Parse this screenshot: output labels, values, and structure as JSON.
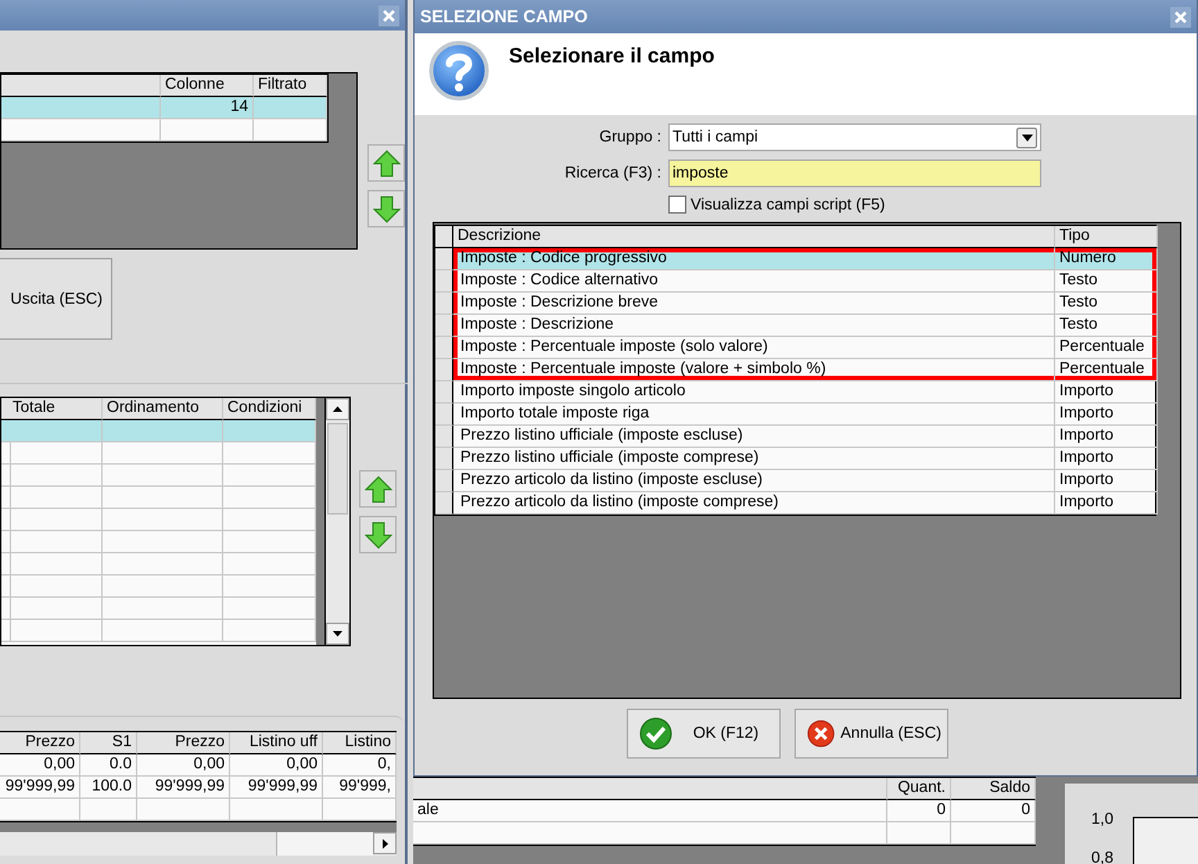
{
  "background_window": {
    "top_table": {
      "columns": [
        "Colonne",
        "Filtrato"
      ],
      "rows": [
        {
          "selected": true,
          "colonne": "14"
        },
        {
          "selected": false
        }
      ]
    },
    "exit_button": "Uscita (ESC)",
    "mid_table": {
      "columns": [
        "Totale",
        "Ordinamento",
        "Condizioni"
      ],
      "rows": [
        {
          "selected": true
        },
        {
          "selected": false
        },
        {
          "selected": false
        },
        {
          "selected": false
        },
        {
          "selected": false
        },
        {
          "selected": false
        },
        {
          "selected": false
        },
        {
          "selected": false
        },
        {
          "selected": false
        },
        {
          "selected": false
        }
      ]
    },
    "bottom_table": {
      "columns": [
        "Prezzo",
        "S1",
        "Prezzo",
        "Listino uff",
        "Listino"
      ],
      "rows": [
        {
          "cells": [
            "0,00",
            "0.0",
            "0,00",
            "0,00",
            "0,"
          ]
        },
        {
          "cells": [
            "99'999,99",
            "100.0",
            "99'999,99",
            "99'999,99",
            "99'999,"
          ]
        }
      ]
    }
  },
  "dialog": {
    "title": "SELEZIONE CAMPO",
    "heading": "Selezionare il campo",
    "group": {
      "label": "Gruppo :",
      "value": "Tutti i campi"
    },
    "search": {
      "label": "Ricerca (F3) :",
      "value": "imposte"
    },
    "script_fields": {
      "label": "Visualizza campi script (F5)",
      "checked": false
    },
    "table": {
      "columns": [
        "Descrizione",
        "Tipo"
      ],
      "rows": [
        {
          "description": "Imposte : Codice progressivo",
          "type": "Numero",
          "selected": true,
          "highlighted": true
        },
        {
          "description": "Imposte : Codice alternativo",
          "type": "Testo",
          "selected": false,
          "highlighted": true
        },
        {
          "description": "Imposte : Descrizione breve",
          "type": "Testo",
          "selected": false,
          "highlighted": true
        },
        {
          "description": "Imposte : Descrizione",
          "type": "Testo",
          "selected": false,
          "highlighted": true
        },
        {
          "description": "Imposte : Percentuale imposte (solo valore)",
          "type": "Percentuale",
          "selected": false,
          "highlighted": true
        },
        {
          "description": "Imposte : Percentuale imposte (valore + simbolo %)",
          "type": "Percentuale",
          "selected": false,
          "highlighted": true
        },
        {
          "description": "Importo imposte singolo articolo",
          "type": "Importo",
          "selected": false,
          "highlighted": false
        },
        {
          "description": "Importo totale imposte riga",
          "type": "Importo",
          "selected": false,
          "highlighted": false
        },
        {
          "description": "Prezzo listino ufficiale (imposte escluse)",
          "type": "Importo",
          "selected": false,
          "highlighted": false
        },
        {
          "description": "Prezzo listino ufficiale (imposte comprese)",
          "type": "Importo",
          "selected": false,
          "highlighted": false
        },
        {
          "description": "Prezzo articolo da listino (imposte escluse)",
          "type": "Importo",
          "selected": false,
          "highlighted": false
        },
        {
          "description": "Prezzo articolo da listino (imposte comprese)",
          "type": "Importo",
          "selected": false,
          "highlighted": false
        }
      ]
    },
    "buttons": [
      {
        "kind": "ok",
        "label": "OK (F12)"
      },
      {
        "kind": "cancel",
        "label": "Annulla (ESC)"
      }
    ]
  },
  "back_window": {
    "columns": [
      "",
      "Quant.",
      "Saldo"
    ],
    "rows": [
      {
        "cells": [
          "ale",
          "0",
          "0"
        ]
      }
    ],
    "axis_labels": [
      "1,0",
      "0,8"
    ]
  }
}
